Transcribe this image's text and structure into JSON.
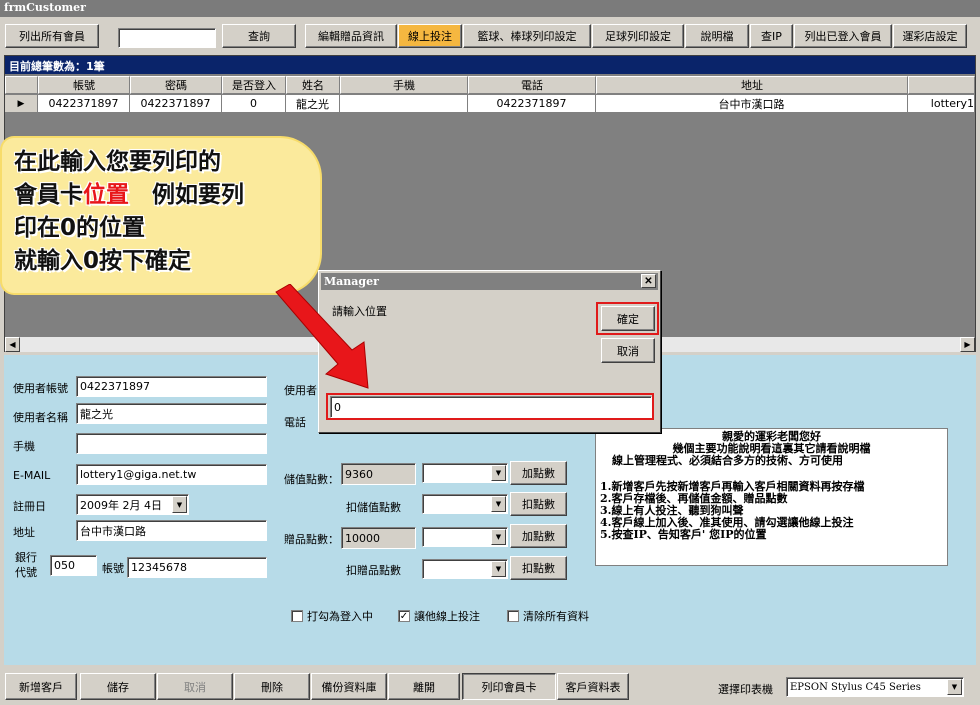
{
  "window": {
    "title": "frmCustomer"
  },
  "toolbar": {
    "list_all": "列出所有會員",
    "search_value": "",
    "query": "查詢",
    "edit_gifts": "編輯贈品資訊",
    "online_bet": "線上投注",
    "basketball_print": "籃球、棒球列印設定",
    "football_print": "足球列印設定",
    "help": "說明檔",
    "check_ip": "查IP",
    "list_logged_in": "列出已登入會員",
    "lottery_store": "運彩店設定"
  },
  "grid": {
    "caption": "目前總筆數為：1筆",
    "columns": [
      "",
      "帳號",
      "密碼",
      "是否登入",
      "姓名",
      "手機",
      "電話",
      "地址",
      ""
    ],
    "row": [
      "▶",
      "0422371897",
      "0422371897",
      "0",
      "龍之光",
      "",
      "0422371897",
      "台中市漢口路",
      "lottery1"
    ]
  },
  "form": {
    "account_label": "使用者帳號",
    "account_value": "0422371897",
    "name_label": "使用者名稱",
    "name_value": "龍之光",
    "mobile_label": "手機",
    "mobile_value": "",
    "email_label": "E-MAIL",
    "email_value": "lottery1@giga.net.tw",
    "register_label": "註冊日",
    "register_value": "2009年  2月  4日",
    "address_label": "地址",
    "address_value": "台中市漢口路",
    "bank_label_1": "銀行",
    "bank_label_2": "代號",
    "bank_code": "050",
    "bank_account_label": "帳號",
    "bank_account_value": "12345678",
    "user_label_partial": "使用者",
    "phone_label": "電話"
  },
  "points": {
    "stored_label": "儲值點數：",
    "stored_value": "9360",
    "add_points": "加點數",
    "deduct_stored_label": "扣儲值點數",
    "deduct_points": "扣點數",
    "gift_label": "贈品點數：",
    "gift_value": "10000",
    "deduct_gift_label": "扣贈品點數"
  },
  "info": {
    "line1": "親愛的運彩老闆您好",
    "line2": "幾個主要功能說明看這裏其它請看說明檔",
    "line3": "線上管理程式、必須結合多方的技術、方可使用",
    "items": [
      "1.新增客戶先按新增客戶再輸入客戶相關資料再按存檔",
      "2.客戶存檔後、再儲值金額、贈品點數",
      "3.線上有人投注、聽到狗叫聲",
      "4.客戶線上加入後、准其使用、請勾選讓他線上投注",
      "5.按查IP、告知客戶' 您IP的位置"
    ]
  },
  "checks": {
    "logged_in": "打勾為登入中",
    "allow_online": "讓他線上投注",
    "clear_all": "清除所有資料"
  },
  "bottom": {
    "new_customer": "新增客戶",
    "save": "儲存",
    "cancel": "取消",
    "delete": "刪除",
    "backup": "備份資料庫",
    "exit": "離開",
    "print_card": "列印會員卡",
    "customer_table": "客戶資料表",
    "printer_label": "選擇印表機",
    "printer_value": "EPSON Stylus C45 Series"
  },
  "dialog": {
    "title": "Manager",
    "prompt": "請輸入位置",
    "ok": "確定",
    "cancel": "取消",
    "input_value": "0"
  },
  "callout": {
    "line1": "在此輸入您要列印的",
    "line2a": "會員卡",
    "line2b": "位置",
    "line2c": "　例如要列",
    "line3": "印在0的位置",
    "line4": "就輸入0按下確定"
  },
  "colors": {
    "highlight_button": "#f5b740",
    "panel": "#b7dbe8",
    "annotation_red": "#e01a1a"
  }
}
